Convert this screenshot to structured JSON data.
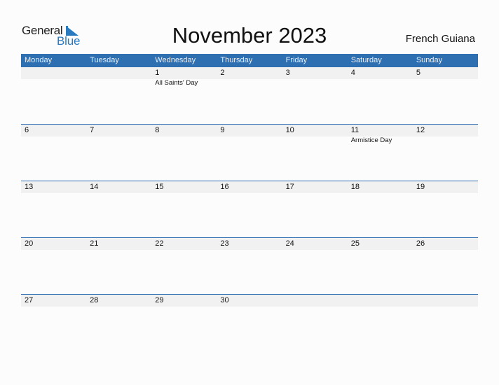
{
  "logo": {
    "word1": "General",
    "word2": "Blue"
  },
  "title": "November 2023",
  "country": "French Guiana",
  "colors": {
    "header_bg": "#2e6fb1",
    "date_strip": "#f1f1f1",
    "logo_blue": "#2a7ac0"
  },
  "weekdays": [
    "Monday",
    "Tuesday",
    "Wednesday",
    "Thursday",
    "Friday",
    "Saturday",
    "Sunday"
  ],
  "weeks": [
    [
      {
        "day": "",
        "holiday": ""
      },
      {
        "day": "",
        "holiday": ""
      },
      {
        "day": "1",
        "holiday": "All Saints' Day"
      },
      {
        "day": "2",
        "holiday": ""
      },
      {
        "day": "3",
        "holiday": ""
      },
      {
        "day": "4",
        "holiday": ""
      },
      {
        "day": "5",
        "holiday": ""
      }
    ],
    [
      {
        "day": "6",
        "holiday": ""
      },
      {
        "day": "7",
        "holiday": ""
      },
      {
        "day": "8",
        "holiday": ""
      },
      {
        "day": "9",
        "holiday": ""
      },
      {
        "day": "10",
        "holiday": ""
      },
      {
        "day": "11",
        "holiday": "Armistice Day"
      },
      {
        "day": "12",
        "holiday": ""
      }
    ],
    [
      {
        "day": "13",
        "holiday": ""
      },
      {
        "day": "14",
        "holiday": ""
      },
      {
        "day": "15",
        "holiday": ""
      },
      {
        "day": "16",
        "holiday": ""
      },
      {
        "day": "17",
        "holiday": ""
      },
      {
        "day": "18",
        "holiday": ""
      },
      {
        "day": "19",
        "holiday": ""
      }
    ],
    [
      {
        "day": "20",
        "holiday": ""
      },
      {
        "day": "21",
        "holiday": ""
      },
      {
        "day": "22",
        "holiday": ""
      },
      {
        "day": "23",
        "holiday": ""
      },
      {
        "day": "24",
        "holiday": ""
      },
      {
        "day": "25",
        "holiday": ""
      },
      {
        "day": "26",
        "holiday": ""
      }
    ],
    [
      {
        "day": "27",
        "holiday": ""
      },
      {
        "day": "28",
        "holiday": ""
      },
      {
        "day": "29",
        "holiday": ""
      },
      {
        "day": "30",
        "holiday": ""
      },
      {
        "day": "",
        "holiday": ""
      },
      {
        "day": "",
        "holiday": ""
      },
      {
        "day": "",
        "holiday": ""
      }
    ]
  ]
}
